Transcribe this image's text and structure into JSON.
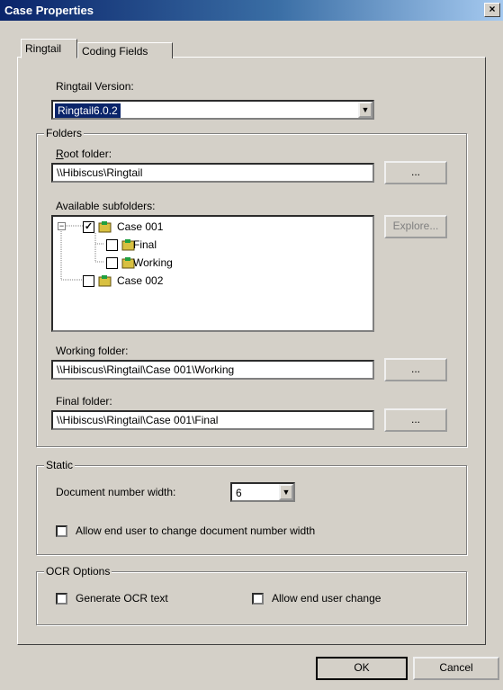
{
  "window": {
    "title": "Case Properties",
    "close_label": "×"
  },
  "tabs": [
    {
      "label": "Ringtail"
    },
    {
      "label": "Coding Fields"
    }
  ],
  "version": {
    "label": "Ringtail Version:",
    "value": "Ringtail6.0.2"
  },
  "folders": {
    "legend": "Folders",
    "root_label": "Root folder:",
    "root_value": "\\\\Hibiscus\\Ringtail",
    "browse_label": "...",
    "subfolders_label": "Available subfolders:",
    "explore_label": "Explore...",
    "tree": [
      {
        "label": "Case 001",
        "checked": true
      },
      {
        "label": "Final",
        "checked": false
      },
      {
        "label": "Working",
        "checked": false
      },
      {
        "label": "Case 002",
        "checked": false
      }
    ],
    "working_label": "Working folder:",
    "working_value": "\\\\Hibiscus\\Ringtail\\Case 001\\Working",
    "final_label": "Final folder:",
    "final_value": "\\\\Hibiscus\\Ringtail\\Case 001\\Final"
  },
  "static": {
    "legend": "Static",
    "docnum_label": "Document number width:",
    "docnum_value": "6",
    "allow_change_label": "Allow end user to change document number width"
  },
  "ocr": {
    "legend": "OCR Options",
    "generate_label": "Generate OCR text",
    "allow_label": "Allow end user change"
  },
  "footer": {
    "ok_label": "OK",
    "cancel_label": "Cancel"
  },
  "colors": {
    "title_start": "#0a246a",
    "title_end": "#a6caf0",
    "dialog_bg": "#d4d0c8",
    "selection": "#0a246a"
  }
}
